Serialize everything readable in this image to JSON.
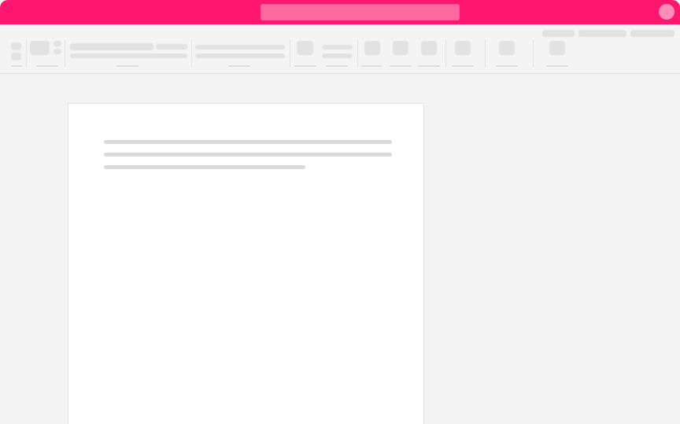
{
  "app": {
    "accent_color": "#ff166f",
    "search": {
      "placeholder": ""
    }
  },
  "ribbon": {
    "icon_names": [
      "undo-icon",
      "redo-icon",
      "paste-icon",
      "cut-icon",
      "copy-icon",
      "style-icon",
      "find-icon",
      "dictate-icon",
      "editor-icon",
      "addins-icon",
      "designer-icon",
      "share-icon"
    ]
  },
  "document": {
    "line_count": 3
  }
}
